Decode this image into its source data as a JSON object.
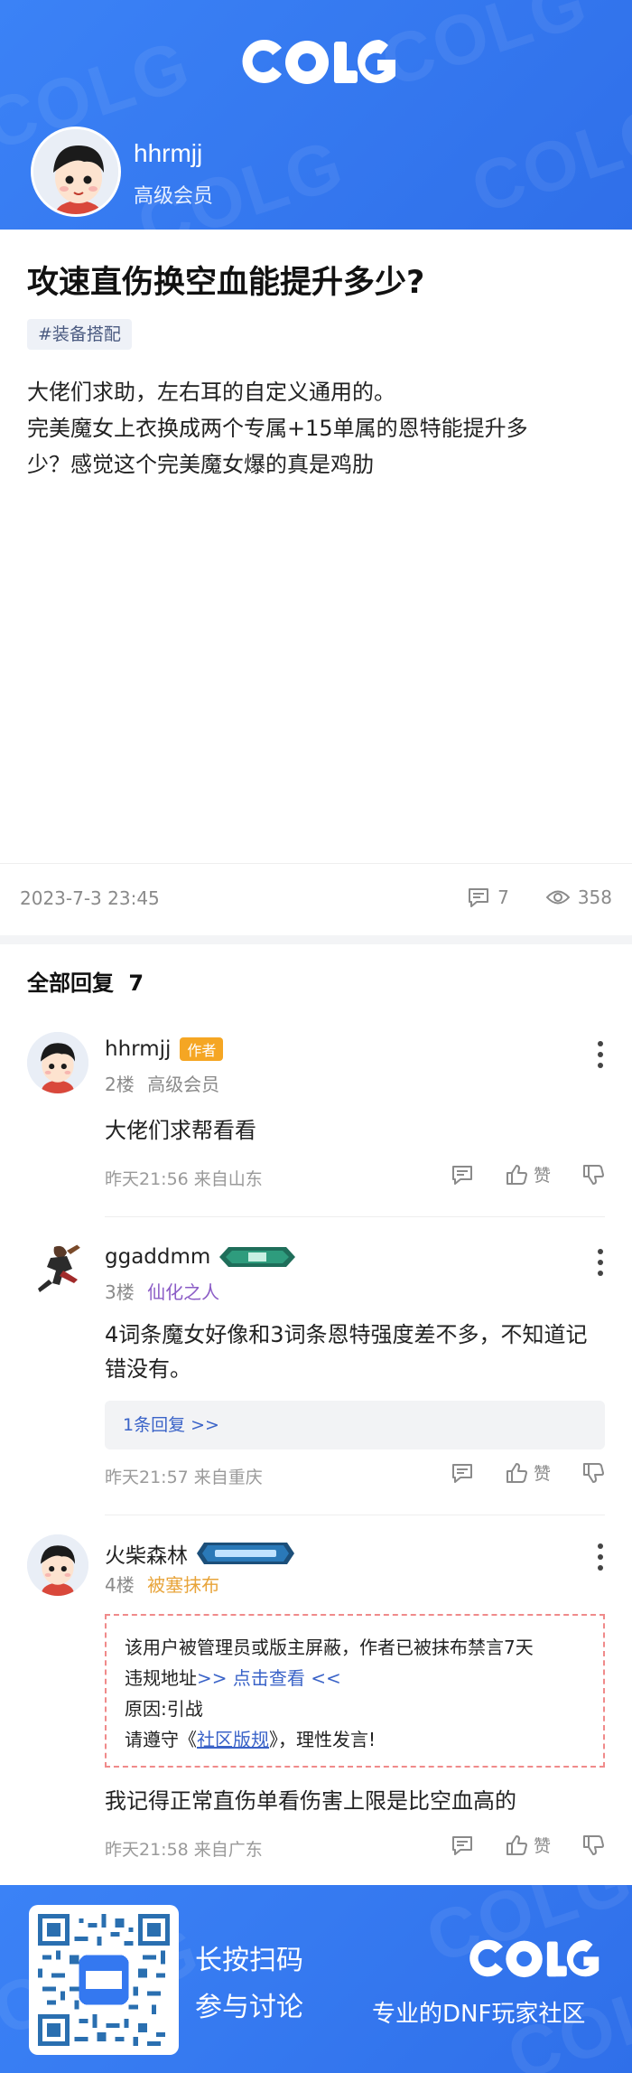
{
  "header": {
    "logo_text": "COLG",
    "username": "hhrmjj",
    "level": "高级会员"
  },
  "post": {
    "title": "攻速直伤换空血能提升多少?",
    "tag": "#装备搭配",
    "body_line1": "大佬们求助，左右耳的自定义通用的。",
    "body_line2": "完美魔女上衣换成两个专属+15单属的恩特能提升多",
    "body_line3": "少？感觉这个完美魔女爆的真是鸡肋",
    "date": "2023-7-3 23:45",
    "comment_count": "7",
    "view_count": "358"
  },
  "replies_header": {
    "label": "全部回复",
    "count": "7"
  },
  "replies": [
    {
      "name": "hhrmjj",
      "badge": "作者",
      "floor": "2楼",
      "role": "高级会员",
      "content": "大佬们求帮看看",
      "time": "昨天21:56 来自山东",
      "like_label": "赞"
    },
    {
      "name": "ggaddmm",
      "floor": "3楼",
      "role": "仙化之人",
      "content": "4词条魔女好像和3词条恩特强度差不多，不知道记错没有。",
      "sub_reply": "1条回复 >>",
      "time": "昨天21:57 来自重庆",
      "like_label": "赞"
    },
    {
      "name": "火柴森林",
      "floor": "4楼",
      "role": "被塞抹布",
      "ban_line1": "该用户被管理员或版主屏蔽，作者已被抹布禁言7天",
      "ban_line2_prefix": "违规地址",
      "ban_line2_link": ">> 点击查看 <<",
      "ban_line3": "原因:引战",
      "ban_line4_prefix": "请遵守《",
      "ban_line4_link": "社区版规",
      "ban_line4_suffix": "》，理性发言!",
      "content": "我记得正常直伤单看伤害上限是比空血高的",
      "time": "昨天21:58 来自广东",
      "like_label": "赞"
    }
  ],
  "footer": {
    "line1": "长按扫码",
    "line2": "参与讨论",
    "logo_text": "COLG",
    "slogan": "专业的DNF玩家社区"
  },
  "colors": {
    "brand_blue": "#3478f0",
    "author_badge": "#f5a623",
    "role_purple": "#8b5cc6",
    "role_orange": "#e8a43a",
    "link_blue": "#3a63c8",
    "ban_border": "#f08a8a"
  }
}
